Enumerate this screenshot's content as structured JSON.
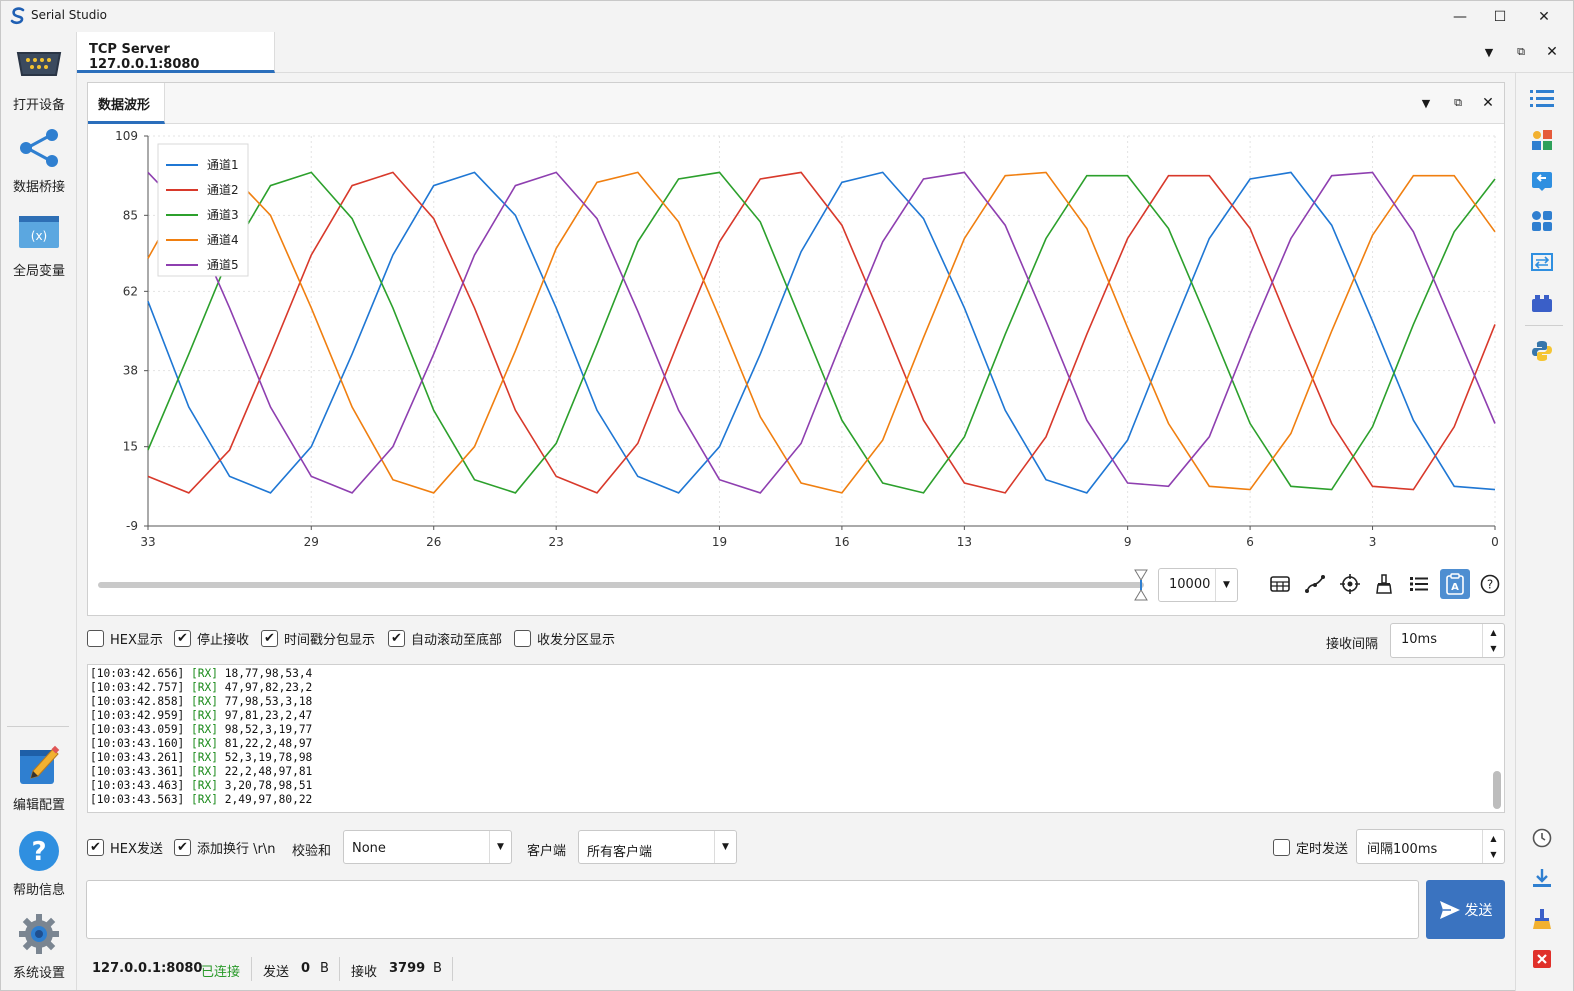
{
  "window": {
    "title": "Serial Studio"
  },
  "tab": {
    "title": "TCP Server 127.0.0.1:8080"
  },
  "panel": {
    "title": "数据波形"
  },
  "left_sidebar": [
    {
      "label": "打开设备",
      "icon": "serial-port-icon"
    },
    {
      "label": "数据桥接",
      "icon": "share-icon"
    },
    {
      "label": "全局变量",
      "icon": "variable-icon"
    },
    {
      "label": "编辑配置",
      "icon": "edit-icon"
    },
    {
      "label": "帮助信息",
      "icon": "help-icon"
    },
    {
      "label": "系统设置",
      "icon": "settings-icon"
    }
  ],
  "right_sidebar_icons": [
    "list-icon",
    "widgets-icon",
    "back-icon",
    "apps-icon",
    "swap-icon",
    "plugin-icon",
    "python-icon",
    "clock-icon",
    "download-icon",
    "clean-icon",
    "close-red-icon"
  ],
  "chart_data": {
    "type": "line",
    "title": "",
    "xlabel": "",
    "ylabel": "",
    "x_ticks": [
      "33",
      "29",
      "26",
      "23",
      "19",
      "16",
      "13",
      "9",
      "6",
      "3",
      "0"
    ],
    "y_ticks": [
      "109",
      "85",
      "62",
      "38",
      "15",
      "-9"
    ],
    "ylim": [
      -9,
      109
    ],
    "xlim": [
      33,
      0
    ],
    "legend_position": "top-left",
    "grid": true,
    "x": [
      33,
      32,
      31,
      30,
      29,
      28,
      27,
      26,
      25,
      24,
      23,
      22,
      21,
      20,
      19,
      18,
      17,
      16,
      15,
      14,
      13,
      12,
      11,
      10,
      9,
      8,
      7,
      6,
      5,
      4,
      3,
      2,
      1,
      0
    ],
    "series": [
      {
        "name": "通道1",
        "color": "#1f77d4",
        "values": [
          59,
          27,
          6,
          1,
          15,
          43,
          73,
          94,
          98,
          85,
          57,
          26,
          6,
          1,
          15,
          43,
          74,
          95,
          98,
          84,
          57,
          26,
          5,
          1,
          17,
          48,
          78,
          96,
          98,
          82,
          53,
          23,
          3,
          2
        ]
      },
      {
        "name": "通道2",
        "color": "#d8392b",
        "values": [
          6,
          1,
          14,
          43,
          73,
          94,
          98,
          84,
          57,
          26,
          6,
          1,
          16,
          47,
          77,
          96,
          98,
          82,
          53,
          23,
          4,
          1,
          18,
          49,
          78,
          97,
          97,
          81,
          51,
          22,
          3,
          2,
          21,
          52
        ]
      },
      {
        "name": "通道3",
        "color": "#2ca02c",
        "values": [
          14,
          43,
          73,
          94,
          98,
          84,
          57,
          26,
          5,
          1,
          16,
          46,
          77,
          96,
          98,
          83,
          53,
          23,
          4,
          1,
          18,
          49,
          78,
          97,
          97,
          81,
          52,
          22,
          3,
          2,
          21,
          52,
          80,
          96
        ]
      },
      {
        "name": "通道4",
        "color": "#f07f10",
        "values": [
          72,
          94,
          98,
          85,
          57,
          27,
          5,
          1,
          15,
          44,
          75,
          95,
          98,
          83,
          54,
          24,
          4,
          1,
          17,
          48,
          78,
          97,
          98,
          81,
          51,
          22,
          3,
          2,
          19,
          50,
          79,
          97,
          97,
          80
        ]
      },
      {
        "name": "通道5",
        "color": "#8e3fb0",
        "values": [
          98,
          85,
          57,
          27,
          6,
          1,
          15,
          43,
          73,
          94,
          98,
          84,
          56,
          26,
          5,
          1,
          16,
          47,
          77,
          96,
          98,
          82,
          53,
          23,
          4,
          3,
          18,
          49,
          78,
          97,
          98,
          80,
          51,
          22
        ]
      }
    ]
  },
  "points_limit": "10000",
  "options": [
    {
      "label": "HEX显示",
      "checked": false
    },
    {
      "label": "停止接收",
      "checked": true
    },
    {
      "label": "时间戳分包显示",
      "checked": true
    },
    {
      "label": "自动滚动至底部",
      "checked": true
    },
    {
      "label": "收发分区显示",
      "checked": false
    }
  ],
  "receive_interval": {
    "label": "接收间隔",
    "value": "10ms"
  },
  "console_lines": [
    {
      "time": "[10:03:42.656]",
      "tag": "[RX]",
      "data": "18,77,98,53,4"
    },
    {
      "time": "[10:03:42.757]",
      "tag": "[RX]",
      "data": "47,97,82,23,2"
    },
    {
      "time": "[10:03:42.858]",
      "tag": "[RX]",
      "data": "77,98,53,3,18"
    },
    {
      "time": "[10:03:42.959]",
      "tag": "[RX]",
      "data": "97,81,23,2,47"
    },
    {
      "time": "[10:03:43.059]",
      "tag": "[RX]",
      "data": "98,52,3,19,77"
    },
    {
      "time": "[10:03:43.160]",
      "tag": "[RX]",
      "data": "81,22,2,48,97"
    },
    {
      "time": "[10:03:43.261]",
      "tag": "[RX]",
      "data": "52,3,19,78,98"
    },
    {
      "time": "[10:03:43.361]",
      "tag": "[RX]",
      "data": "22,2,48,97,81"
    },
    {
      "time": "[10:03:43.463]",
      "tag": "[RX]",
      "data": "3,20,78,98,51"
    },
    {
      "time": "[10:03:43.563]",
      "tag": "[RX]",
      "data": "2,49,97,80,22"
    }
  ],
  "send": {
    "hex_send": {
      "label": "HEX发送",
      "checked": true
    },
    "add_newline": {
      "label": "添加换行 \\r\\n",
      "checked": true
    },
    "checksum_label": "校验和",
    "checksum_value": "None",
    "client_label": "客户端",
    "client_value": "所有客户端",
    "timed_send": {
      "label": "定时发送",
      "checked": false
    },
    "interval_value": "间隔100ms",
    "input_value": "",
    "button_label": "发送"
  },
  "status": {
    "address": "127.0.0.1:8080",
    "state": "已连接",
    "sent_label": "发送",
    "sent_value": "0",
    "sent_unit": "B",
    "recv_label": "接收",
    "recv_value": "3799",
    "recv_unit": "B"
  }
}
